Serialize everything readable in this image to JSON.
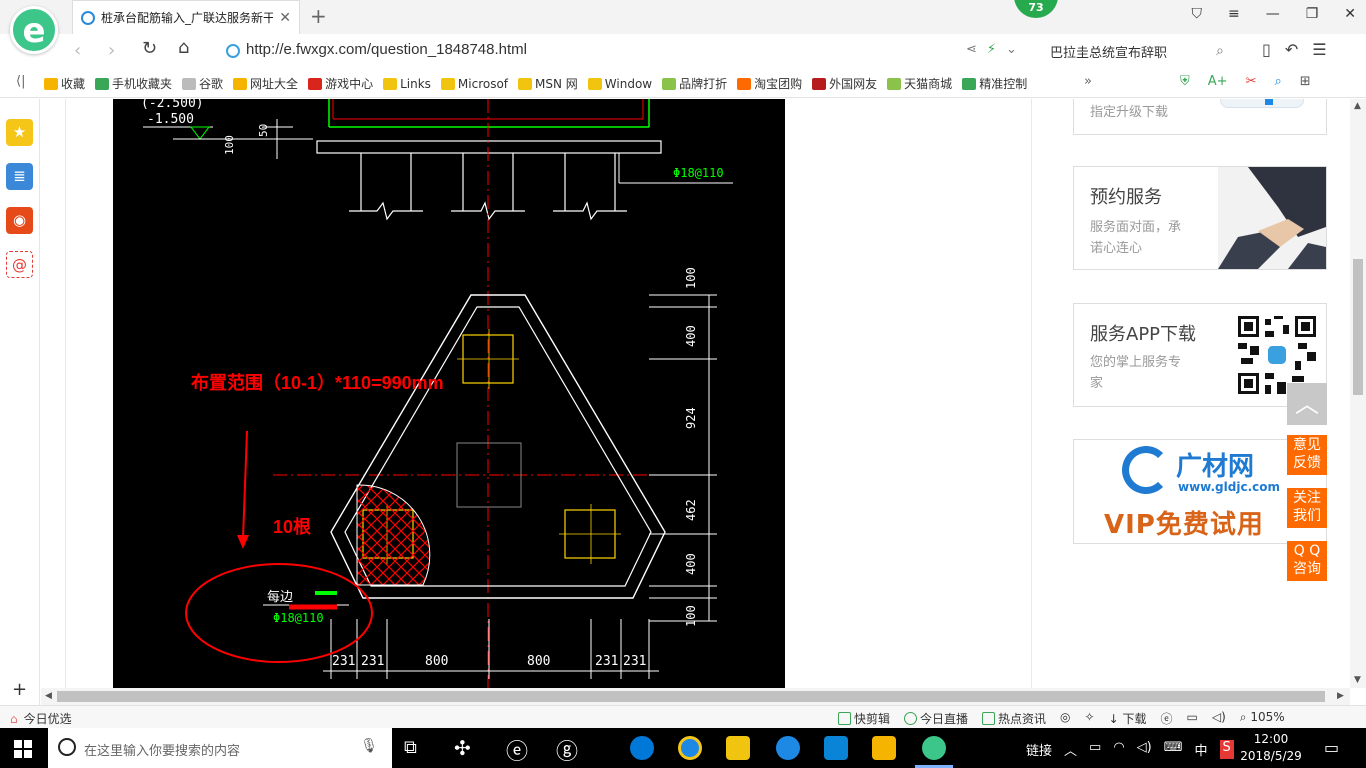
{
  "browser": {
    "tab_title": "桩承台配筋输入_广联达服务新干",
    "notification_count": "73",
    "url": "http://e.fwxgx.com/question_1848748.html",
    "search_text": "巴拉圭总统宣布辞职"
  },
  "bookmarks": [
    {
      "label": "收藏",
      "color": "#f5b400"
    },
    {
      "label": "手机收藏夹",
      "color": "#3aa657"
    },
    {
      "label": "谷歌",
      "color": "#bbbbbb"
    },
    {
      "label": "网址大全",
      "color": "#f5b400"
    },
    {
      "label": "游戏中心",
      "color": "#d9251c"
    },
    {
      "label": "Links",
      "color": "#f1c40f"
    },
    {
      "label": "Microsof",
      "color": "#f1c40f"
    },
    {
      "label": "MSN 网",
      "color": "#f1c40f"
    },
    {
      "label": "Window",
      "color": "#f1c40f"
    },
    {
      "label": "品牌打折",
      "color": "#8bc34a"
    },
    {
      "label": "淘宝团购",
      "color": "#ff6a00"
    },
    {
      "label": "外国网友",
      "color": "#b71c1c"
    },
    {
      "label": "天猫商城",
      "color": "#8bc34a"
    },
    {
      "label": "精准控制",
      "color": "#3aa657"
    }
  ],
  "cad": {
    "annotation": "布置范围（10-1）*110=990mm",
    "count_label": "10根",
    "elev1": "(-2.500)",
    "elev2": "-1.500",
    "dim_50": "50",
    "dim_100_left": "100",
    "rebar_top": "Φ18@110",
    "rebar_bottom": "Φ18@110",
    "edge_label": "每边",
    "dims_right": [
      "100",
      "400",
      "924",
      "462",
      "400",
      "100"
    ],
    "dims_bottom": [
      "231",
      "231",
      "800",
      "800",
      "231",
      "231"
    ]
  },
  "sidebar": {
    "upgrade_text": "指定升级下载",
    "appointment_title": "预约服务",
    "appointment_desc1": "服务面对面，承",
    "appointment_desc2": "诺心连心",
    "app_title": "服务APP下载",
    "app_desc1": "您的掌上服务专",
    "app_desc2": "家",
    "ad_brand": "广材网",
    "ad_url": "www.gldjc.com",
    "ad_slogan": "VIP免费试用"
  },
  "float_buttons": [
    {
      "line1": "意见",
      "line2": "反馈"
    },
    {
      "line1": "关注",
      "line2": "我们"
    },
    {
      "line1": "Q Q",
      "line2": "咨询"
    }
  ],
  "status": {
    "left_label": "今日优选",
    "quick_edit": "快剪辑",
    "live": "今日直播",
    "hot_news": "热点资讯",
    "download": "下载",
    "zoom": "105%"
  },
  "taskbar": {
    "search_placeholder": "在这里输入你要搜索的内容",
    "link_label": "链接",
    "ime": "中",
    "time": "12:00",
    "date": "2018/5/29"
  }
}
